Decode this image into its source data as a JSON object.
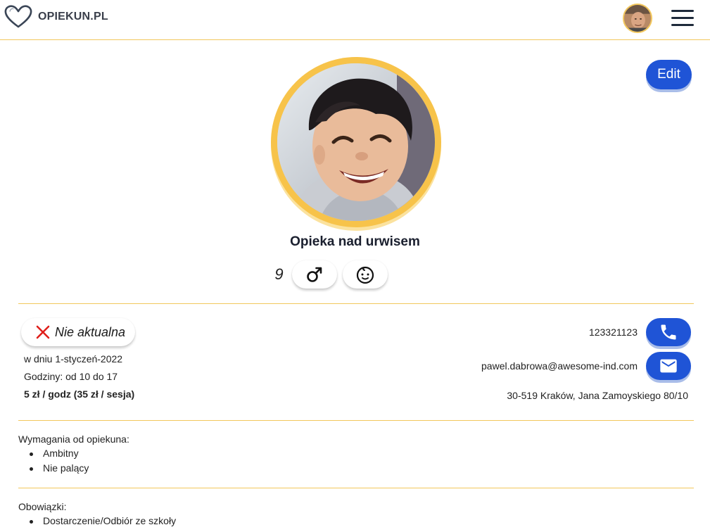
{
  "header": {
    "brand": "OPIEKUN.PL",
    "logo_icon": "heart-outline-icon",
    "menu_icon": "hamburger-menu-icon"
  },
  "edit_label": "Edit",
  "profile": {
    "title": "Opieka nad urwisem",
    "age": "9",
    "gender_icon": "male-symbol-icon",
    "child_icon": "baby-face-icon"
  },
  "status": {
    "label": "Nie aktualna",
    "icon": "close-x-icon",
    "date": "w dniu 1-styczeń-2022",
    "hours": "Godziny: od 10 do 17",
    "rate": "5 zł / godz (35 zł / sesja)"
  },
  "contact": {
    "phone": "123321123",
    "email": "pawel.dabrowa@awesome-ind.com",
    "address": "30-519 Kraków, Jana Zamoyskiego 80/10",
    "phone_icon": "phone-icon",
    "email_icon": "envelope-icon"
  },
  "requirements": {
    "label": "Wymagania od opiekuna:",
    "items": [
      "Ambitny",
      "Nie palący"
    ]
  },
  "duties": {
    "label": "Obowiązki:",
    "items": [
      "Dostarczenie/Odbiór ze szkoły"
    ]
  },
  "colors": {
    "accent_yellow": "#f2c75c",
    "primary_blue": "#1f54d6",
    "close_red": "#e0201b"
  }
}
